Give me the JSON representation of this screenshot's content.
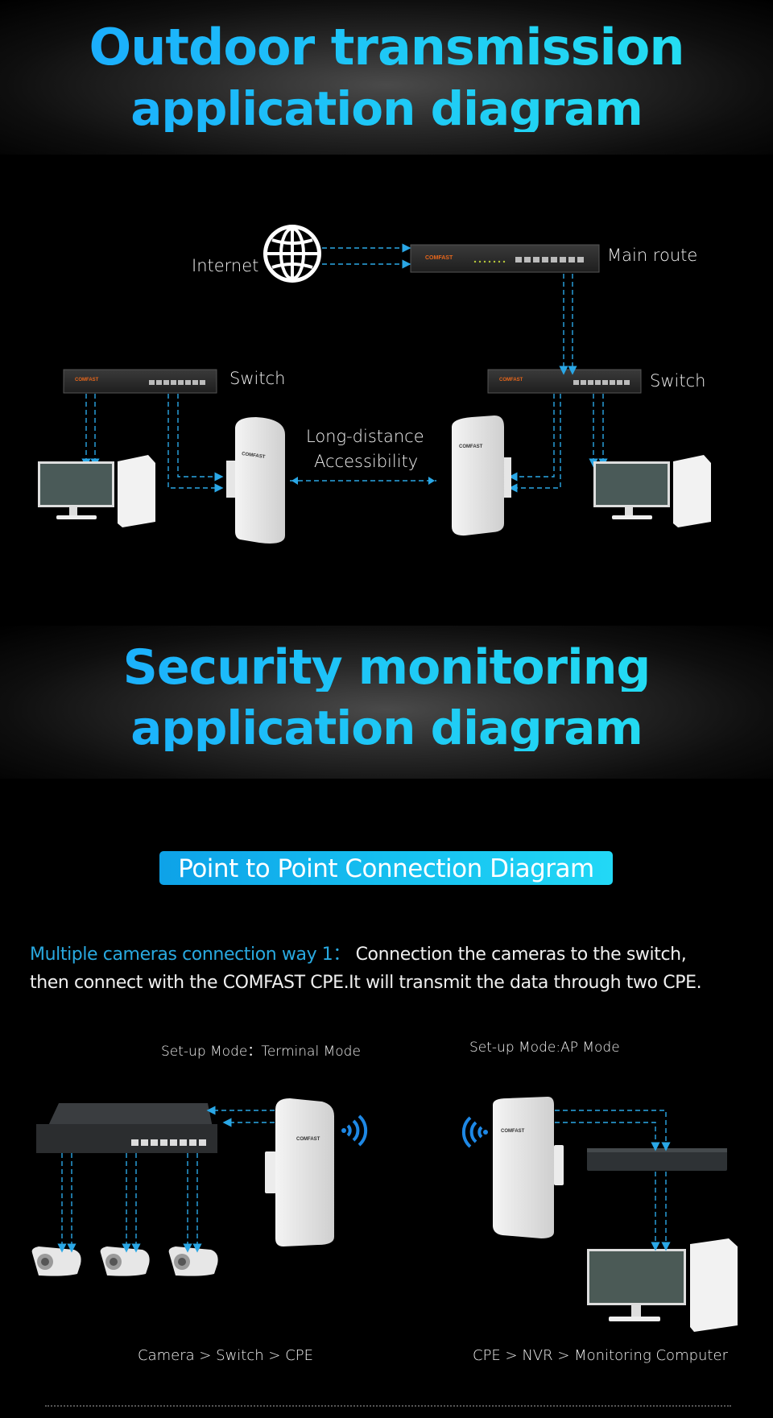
{
  "banners": {
    "outdoor": {
      "line1": "Outdoor transmission",
      "line2": "application diagram"
    },
    "security": {
      "line1": "Security monitoring",
      "line2": "application diagram"
    }
  },
  "outdoor_diagram": {
    "internet_label": "Internet",
    "main_route_label": "Main route",
    "switch_left_label": "Switch",
    "switch_right_label": "Switch",
    "link_label_line1": "Long-distance",
    "link_label_line2": "Accessibility",
    "brand": "COMFAST"
  },
  "ptp_badge": "Point to Point Connection Diagram",
  "description": {
    "highlight": "Multiple cameras connection way 1：",
    "text_line1": " Connection the cameras to the switch,",
    "text_line2": "then connect with the COMFAST CPE.It will transmit the data through two CPE."
  },
  "security_diagram": {
    "left_mode_label": "Set-up Mode：Terminal Mode",
    "right_mode_label": "Set-up Mode:AP Mode",
    "left_flow": "Camera > Switch > CPE",
    "right_flow": "CPE > NVR > Monitoring Computer",
    "brand": "COMFAST"
  },
  "colors": {
    "accent": "#1fb6f2",
    "arrow": "#2aa7e6",
    "background": "#000000"
  }
}
